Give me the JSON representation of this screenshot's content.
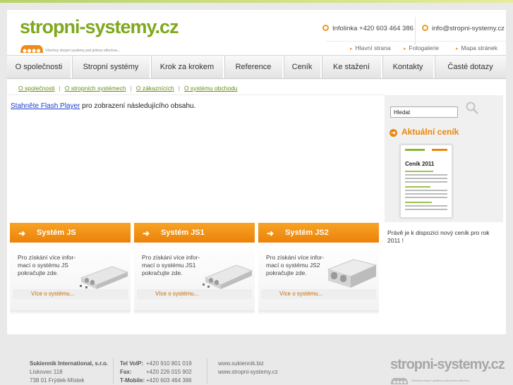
{
  "header": {
    "logo_text": "stropni-systemy.cz",
    "logo_tagline": "Všechny stropní systémy pod jednou střechou...",
    "hotline": "Infolinka +420 603 464 386",
    "email": "info@stropni-systemy.cz",
    "links": [
      "Hlavní strana",
      "Fotogalerie",
      "Mapa stránek"
    ]
  },
  "nav": {
    "items": [
      "O společnosti",
      "Stropní systémy",
      "Krok za krokem",
      "Reference",
      "Ceník",
      "Ke stažení",
      "Kontakty",
      "Časté dotazy"
    ]
  },
  "breadcrumb": {
    "items": [
      "O společnosti",
      "O stropních systémech",
      "O zákaznících",
      "O systému obchodu"
    ],
    "separator": "|"
  },
  "flash_notice": {
    "link": "Stahněte Flash Player",
    "text": " pro zobrazení následujícího obsahu."
  },
  "sidebar": {
    "search_value": "Hledat",
    "pricelist_title": "Aktuální ceník",
    "pricelist_image_title": "Ceník 2011",
    "pricelist_note": "Právě je k dispozici nový ceník pro rok 2011 !"
  },
  "systems": [
    {
      "title": "Systém JS",
      "desc": "Pro získání více infor-mací o systému JS pokračujte zde.",
      "more": "Více o systému..."
    },
    {
      "title": "Systém JS1",
      "desc": "Pro získání více infor-mací o systému JS1 pokračujte zde.",
      "more": "Více o systému..."
    },
    {
      "title": "Systém JS2",
      "desc": "Pro získání více infor-mací o systému JS2 pokračujte zde.",
      "more": "Více o systému..."
    }
  ],
  "footer": {
    "company": "Sukiennik International, s.r.o.",
    "street": "Lískovec 118",
    "city": "738 01 Frýdek-Místek",
    "tel_voip_label": "Tel VoIP:",
    "tel_voip": "+420 910 801 019",
    "fax_label": "Fax:",
    "fax": "+420 226 015 902",
    "mobile_label": "T-Mobile:",
    "mobile": "+420 603 464 386",
    "web1": "www.sukiennik.biz",
    "web2": "www.stropni-systemy.cz",
    "logo_text": "stropni-systemy.cz",
    "logo_tagline": "Všechny stropní systémy pod jednou střechou..."
  },
  "colors": {
    "brand_green": "#7fa81e",
    "accent_orange": "#ec8109",
    "link_blue": "#1a3dcc"
  },
  "icons": [
    "hotline-icon",
    "email-icon",
    "arrow-icon",
    "search-icon",
    "arrow-right-icon"
  ]
}
